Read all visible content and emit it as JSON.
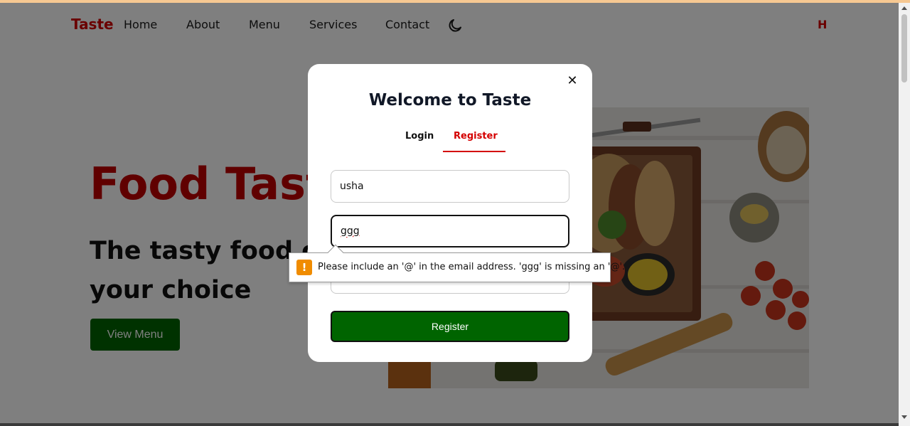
{
  "nav": {
    "brand": "Taste",
    "links": [
      "Home",
      "About",
      "Menu",
      "Services",
      "Contact"
    ],
    "right_text": "H"
  },
  "hero": {
    "title": "Food Taste",
    "subtitle": "The tasty food of your choice",
    "button": "View Menu"
  },
  "modal": {
    "title": "Welcome to Taste",
    "tabs": [
      "Login",
      "Register"
    ],
    "active_tab": "Register",
    "name_value": "usha",
    "email_value": "ggg",
    "submit": "Register"
  },
  "validation": {
    "message": "Please include an '@' in the email address. 'ggg' is missing an '@'."
  },
  "colors": {
    "brand_red": "#d40000",
    "button_green": "#006400",
    "warning": "#f08c00"
  }
}
